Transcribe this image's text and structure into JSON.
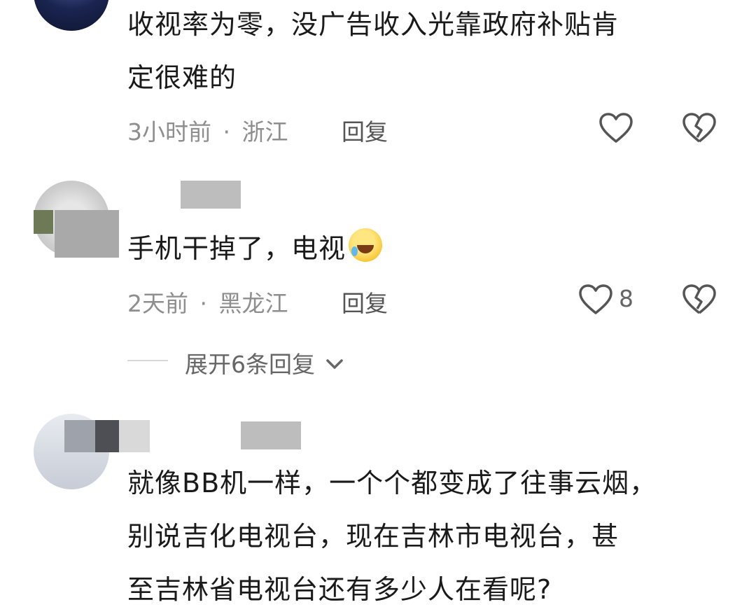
{
  "comments": [
    {
      "text_lines": [
        "收视率为零，没广告收入光靠政府补贴肯",
        "定很难的"
      ],
      "time": "3小时前",
      "sep": "·",
      "location": "浙江",
      "reply": "回复",
      "likes": ""
    },
    {
      "text_lines": [
        "手机干掉了，电视"
      ],
      "emoji": "laughing-tears-emoji",
      "time": "2天前",
      "sep": "·",
      "location": "黑龙江",
      "reply": "回复",
      "likes": "8",
      "expand": "展开6条回复"
    },
    {
      "text_lines": [
        "就像BB机一样，一个个都变成了往事云烟，",
        "别说吉化电视台，现在吉林市电视台，甚",
        "至吉林省电视台还有多少人在看呢?"
      ]
    }
  ],
  "icons": {
    "like": "heart-outline-icon",
    "dislike": "broken-heart-icon",
    "expand": "chevron-down-icon"
  },
  "colors": {
    "meta": "#8e8e8e",
    "text": "#1a1a1a",
    "icon": "#555555"
  }
}
